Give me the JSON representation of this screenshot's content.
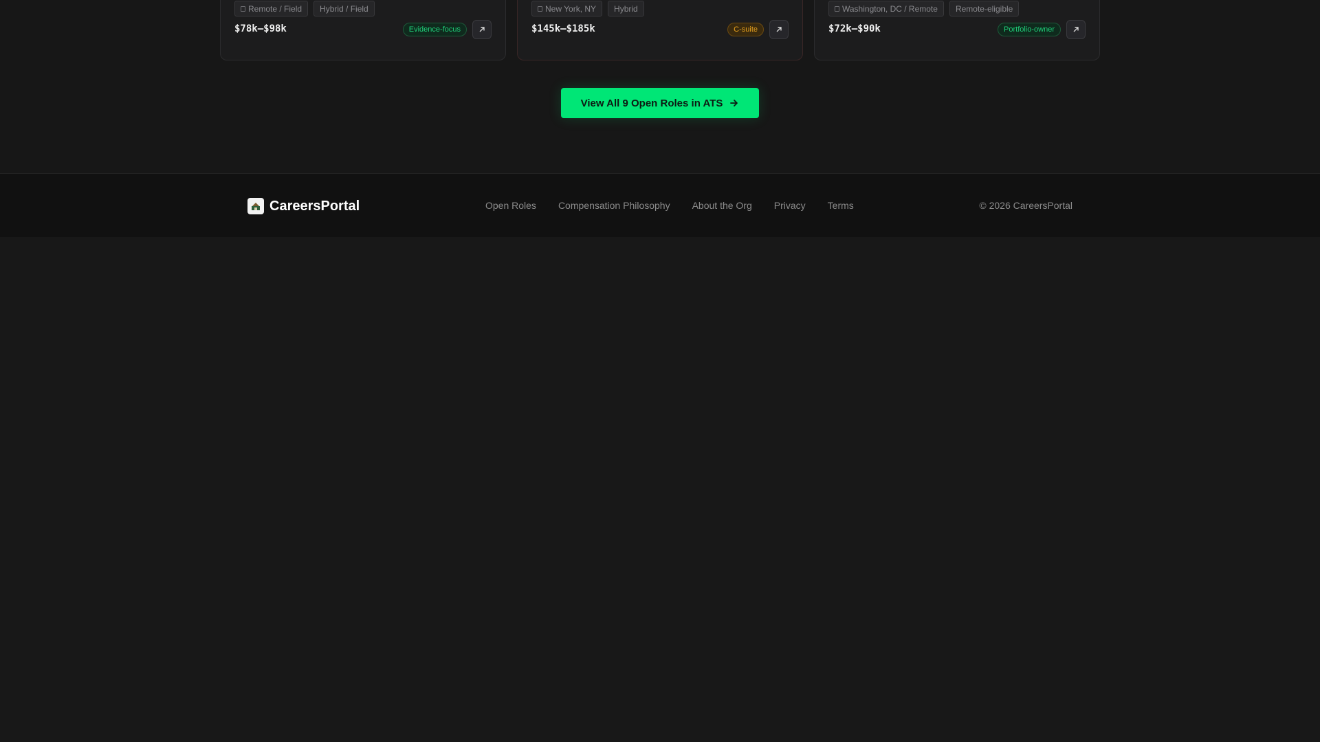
{
  "cards": [
    {
      "tags": [
        {
          "icon": "location-pin-icon",
          "label": "Remote / Field"
        },
        {
          "label": "Hybrid / Field"
        }
      ],
      "salary": "$78k–$98k",
      "badge": {
        "label": "Evidence-focus",
        "color": "#1fd07a"
      }
    },
    {
      "tags": [
        {
          "icon": "location-pin-icon",
          "label": "New York, NY"
        },
        {
          "label": "Hybrid"
        }
      ],
      "salary": "$145k–$185k",
      "badge": {
        "label": "C-suite",
        "color": "#e8a21f"
      }
    },
    {
      "tags": [
        {
          "icon": "location-pin-icon",
          "label": "Washington, DC / Remote"
        },
        {
          "label": "Remote-eligible"
        }
      ],
      "salary": "$72k–$90k",
      "badge": {
        "label": "Portfolio-owner",
        "color": "#1fd07a"
      }
    }
  ],
  "cta": {
    "label": "View All 9 Open Roles in ATS",
    "icon": "arrow-right-icon",
    "color": "#00e676"
  },
  "footer": {
    "brand_name": "CareersPortal",
    "brand_icon": "logo-icon",
    "links": [
      "Open Roles",
      "Compensation Philosophy",
      "About the Org",
      "Privacy",
      "Terms"
    ],
    "copyright": "© 2026 CareersPortal"
  }
}
